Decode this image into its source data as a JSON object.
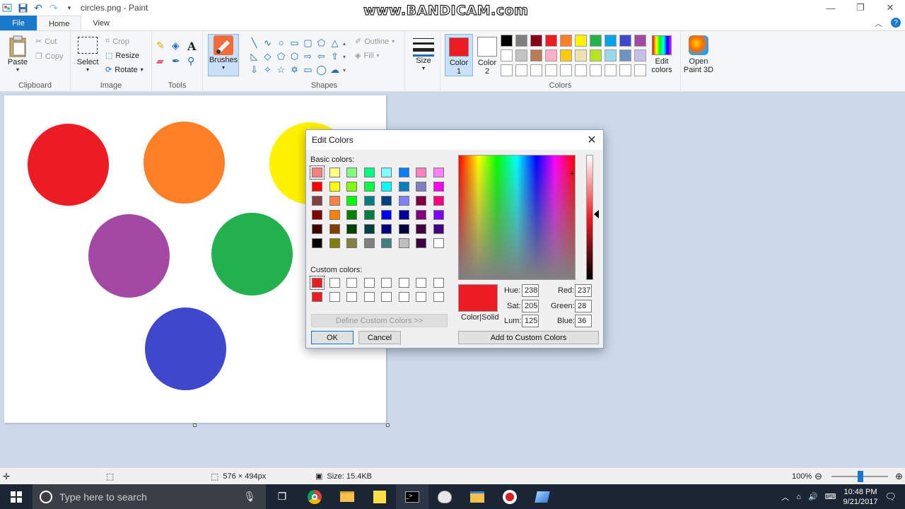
{
  "app": {
    "title": "circles.png - Paint",
    "watermark": "www.BANDICAM.com"
  },
  "tabs": [
    {
      "label": "File"
    },
    {
      "label": "Home"
    },
    {
      "label": "View"
    }
  ],
  "ribbon": {
    "clipboard": {
      "group": "Clipboard",
      "paste": "Paste",
      "cut": "Cut",
      "copy": "Copy"
    },
    "image": {
      "group": "Image",
      "select": "Select",
      "crop": "Crop",
      "resize": "Resize",
      "rotate": "Rotate"
    },
    "tools": {
      "group": "Tools"
    },
    "brushes": {
      "label": "Brushes"
    },
    "shapes": {
      "group": "Shapes",
      "outline": "Outline",
      "fill": "Fill"
    },
    "size": {
      "label": "Size"
    },
    "colors": {
      "group": "Colors",
      "color1_label": "Color 1",
      "color2_label": "Color 2",
      "color1": "#ed1c24",
      "color2": "#ffffff",
      "edit_colors": "Edit colors",
      "palette": [
        "#000000",
        "#7f7f7f",
        "#880015",
        "#ed1c24",
        "#ff7f27",
        "#fff200",
        "#22b14c",
        "#00a2e8",
        "#3f48cc",
        "#a349a4",
        "#ffffff",
        "#c3c3c3",
        "#b97a57",
        "#ffaec9",
        "#ffc90e",
        "#efe4b0",
        "#b5e61d",
        "#99d9ea",
        "#7092be",
        "#c8bfe7",
        "#ffffff",
        "#ffffff",
        "#ffffff",
        "#ffffff",
        "#ffffff",
        "#ffffff",
        "#ffffff",
        "#ffffff",
        "#ffffff",
        "#ffffff"
      ]
    },
    "paint3d": {
      "label": "Open Paint 3D"
    }
  },
  "canvas": {
    "circles": [
      {
        "color": "#ed1c24"
      },
      {
        "color": "#ff7f27"
      },
      {
        "color": "#fff200"
      },
      {
        "color": "#a349a4"
      },
      {
        "color": "#22b14c"
      },
      {
        "color": "#3f48cc"
      }
    ]
  },
  "dialog": {
    "title": "Edit Colors",
    "basic_colors_label": "Basic colors:",
    "basic_colors": [
      "#ff8080",
      "#ffff80",
      "#80ff80",
      "#00ff80",
      "#80ffff",
      "#0080ff",
      "#ff80c0",
      "#ff80ff",
      "#ff0000",
      "#ffff00",
      "#80ff00",
      "#00ff40",
      "#00ffff",
      "#0080c0",
      "#8080c0",
      "#ff00ff",
      "#804040",
      "#ff8040",
      "#00ff00",
      "#008080",
      "#004080",
      "#8080ff",
      "#800040",
      "#ff0080",
      "#800000",
      "#ff8000",
      "#008000",
      "#008040",
      "#0000ff",
      "#0000a0",
      "#800080",
      "#8000ff",
      "#400000",
      "#804000",
      "#004000",
      "#004040",
      "#000080",
      "#000040",
      "#400040",
      "#400080",
      "#000000",
      "#808000",
      "#808040",
      "#808080",
      "#408080",
      "#c0c0c0",
      "#400040",
      "#ffffff"
    ],
    "custom_colors_label": "Custom colors:",
    "custom_colors": [
      "#ed1c24",
      "#ffffff",
      "#ffffff",
      "#ffffff",
      "#ffffff",
      "#ffffff",
      "#ffffff",
      "#ffffff",
      "#ed1c24",
      "#ffffff",
      "#ffffff",
      "#ffffff",
      "#ffffff",
      "#ffffff",
      "#ffffff",
      "#ffffff"
    ],
    "define_custom": "Define Custom Colors >>",
    "ok": "OK",
    "cancel": "Cancel",
    "color_solid": "Color|Solid",
    "preview_color": "#ed1c24",
    "hue_label": "Hue:",
    "hue": "238",
    "sat_label": "Sat:",
    "sat": "205",
    "lum_label": "Lum:",
    "lum": "125",
    "red_label": "Red:",
    "red": "237",
    "green_label": "Green:",
    "green": "28",
    "blue_label": "Blue:",
    "blue": "36",
    "add_custom": "Add to Custom Colors"
  },
  "status": {
    "dimensions": "576 × 494px",
    "size": "Size: 15.4KB",
    "zoom": "100%"
  },
  "taskbar": {
    "search_placeholder": "Type here to search",
    "time": "10:48 PM",
    "date": "9/21/2017"
  }
}
